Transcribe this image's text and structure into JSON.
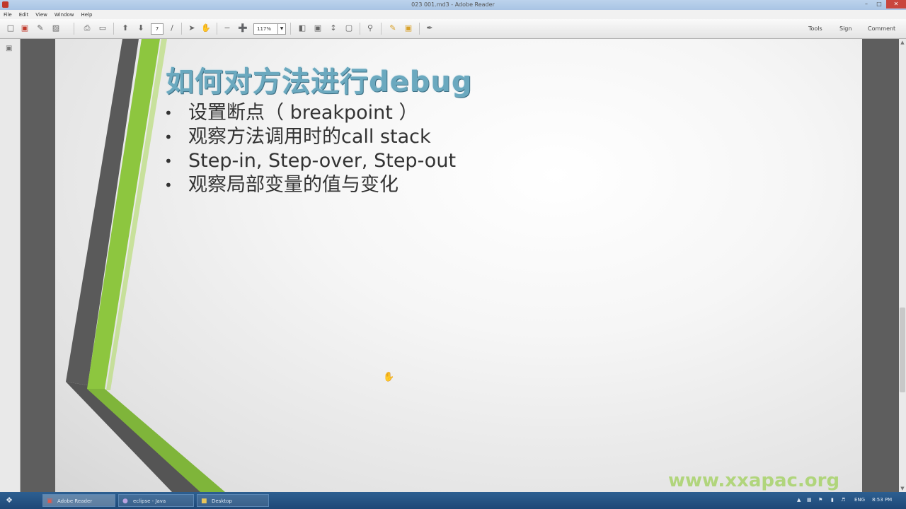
{
  "window": {
    "title": "023 001.md3 - Adobe Reader",
    "minimize_icon": "minimize-icon",
    "close_icon": "close-icon"
  },
  "menu": [
    "File",
    "Edit",
    "View",
    "Window",
    "Help"
  ],
  "toolbar": {
    "page_number": "7",
    "zoom": "117%",
    "tools_label": "Tools",
    "sign_label": "Sign",
    "comment_label": "Comment"
  },
  "slide": {
    "title": "如何对方法进行debug",
    "bullets": [
      "设置断点（ breakpoint ）",
      "观察方法调用时的call stack",
      "Step-in, Step-over, Step-out",
      "观察局部变量的值与变化"
    ],
    "watermark": "www.xxapac.org",
    "colors": {
      "title": "#6ba9bf",
      "accent_green": "#8dc63f",
      "stripe_dark": "#4a4a4a"
    }
  },
  "taskbar": {
    "tasks": [
      {
        "label": "Adobe Reader",
        "icon": "pdf-icon",
        "active": true
      },
      {
        "label": "eclipse - Java",
        "icon": "eclipse-icon",
        "active": false
      },
      {
        "label": "Desktop",
        "icon": "folder-icon",
        "active": false
      }
    ],
    "tray_lang": "ENG",
    "clock": "8:53 PM"
  }
}
